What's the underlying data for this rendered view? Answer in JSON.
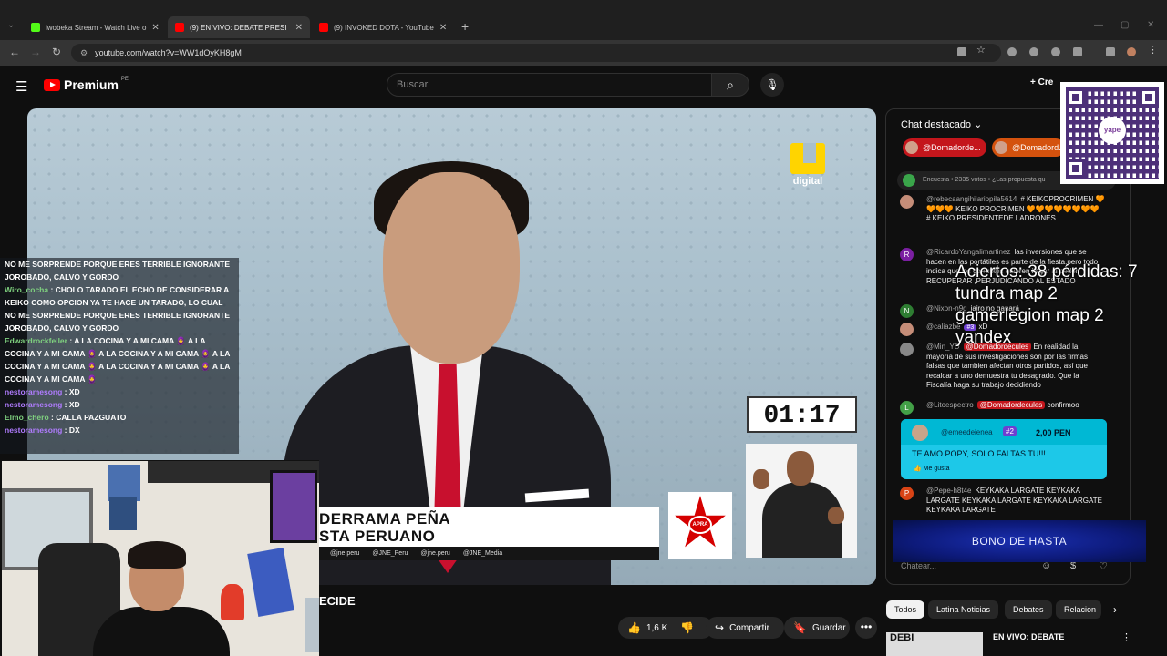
{
  "browser": {
    "tabs": [
      {
        "title": "iwobeka Stream - Watch Live o",
        "favicon_color": "#53fc18"
      },
      {
        "title": "(9) EN VIVO: DEBATE PRESI",
        "favicon_color": "#ff0000"
      },
      {
        "title": "(9) INVOKED DOTA - YouTube",
        "favicon_color": "#ff0000"
      }
    ],
    "url": "youtube.com/watch?v=WW1dOyKH8gM"
  },
  "youtube": {
    "logo_text": "Premium",
    "country": "PE",
    "search_placeholder": "Buscar",
    "create_label": "Cre"
  },
  "video": {
    "channel_mark": "digital",
    "timer": "01:17",
    "lower_third_line1": "DERRAMA PEÑA",
    "lower_third_line2": "STA PERUANO",
    "socials": [
      "@jne.peru",
      "@JNE_Peru",
      "@jne.peru",
      "@JNE_Media"
    ],
    "party_logo_text": "APRA",
    "title_fragment": "ECIDE"
  },
  "stream_chat": [
    {
      "user": "",
      "text": "NO ME SORPRENDE PORQUE ERES TERRIBLE IGNORANTE JOROBADO, CALVO Y GORDO"
    },
    {
      "user": "Wiro_cocha",
      "text": ": CHOLO TARADO EL ECHO DE CONSIDERAR A KEIKO COMO OPCION YA TE HACE UN TARADO, LO CUAL NO ME SORPRENDE PORQUE ERES TERRIBLE IGNORANTE JOROBADO, CALVO Y GORDO"
    },
    {
      "user": "Edwardrockfeller",
      "text": ": A LA COCINA Y A MI CAMA 🧕 A LA COCINA Y A MI CAMA 🧕 A LA COCINA Y A MI CAMA 🧕 A LA COCINA Y A MI CAMA 🧕 A LA COCINA Y A MI CAMA 🧕 A LA COCINA Y A MI CAMA 🧕"
    },
    {
      "user": "nestoramesong",
      "text": ": XD"
    },
    {
      "user": "nestoramesong",
      "text": ": XD"
    },
    {
      "user": "Elmo_chero",
      "text": ": CALLA PAZGUATO"
    },
    {
      "user": "nestoramesong",
      "text": ": DX"
    }
  ],
  "actions": {
    "likes": "1,6 K",
    "share": "Compartir",
    "save": "Guardar"
  },
  "live_chat": {
    "header": "Chat destacado",
    "pinned": [
      "@Domadorde...",
      "@Domadord..."
    ],
    "poll": "Encuesta • 2335 votos • ¿Las propuesta qu",
    "messages": [
      {
        "name": "@rebecaangihilariopila5614",
        "text": "# KEIKOPROCRIMEN 🧡🧡🧡🧡 KEIKO PROCRIMEN 🧡🧡🧡🧡🧡🧡🧡🧡 # KEIKO PRESIDENTEDE LADRONES",
        "avatar": ""
      },
      {
        "name": "@RicardoYangalimartinez",
        "text": "las inversiones que se hacen en las portátiles es parte de la fiesta,pero todo indica que los corruptos quieren llegar al poder RECUPERAR ,PERJUDICANDO AL ESTADO",
        "avatar": "R"
      },
      {
        "name": "@Nixon-n9g",
        "text": "jairo no ganará",
        "avatar": "N"
      },
      {
        "name": "@caliazbe",
        "text": "xD",
        "badge": "#3",
        "avatar": ""
      },
      {
        "name": "@Min_YD",
        "mention": "@Domadordecules",
        "text": "En realidad la mayoría de sus investigaciones son por las firmas falsas que tambien afectan otros partidos, así que recalcar a uno demuestra tu desagrado. Que la Fiscalía haga su trabajo decidiendo",
        "avatar": ""
      },
      {
        "name": "@Litoespectro",
        "mention": "@Domadordecules",
        "text": "confirmoo",
        "avatar": "L"
      },
      {
        "name": "@Pepe-h8t4e",
        "text": "KEYKAKA LARGATE KEYKAKA LARGATE KEYKAKA LARGATE KEYKAKA LARGATE KEYKAKA LARGATE",
        "avatar": "P"
      }
    ],
    "superchat": {
      "name": "@emeedeienea",
      "badge": "#2",
      "amount": "2,00 PEN",
      "text": "TE AMO POPY, SOLO FALTAS TU!!!",
      "like": "Me gusta"
    },
    "banner": "BONO DE HASTA",
    "input_placeholder": "Chatear..."
  },
  "overlay_stats": [
    "Aciertos: 38 pérdidas: 7",
    "tundra map 2",
    "gamerlegion map 2",
    "yandex"
  ],
  "qr_brand": "yape",
  "chips": [
    "Todos",
    "Latina Noticias",
    "Debates",
    "Relacion"
  ],
  "suggestion": {
    "title": "EN VIVO: DEBATE",
    "thumb_text": "DEBI"
  },
  "colors": {
    "youtube_red": "#ff0000",
    "superchat": "#00b8d4",
    "mention": "#c4161c",
    "kick_green": "#53fc18"
  }
}
